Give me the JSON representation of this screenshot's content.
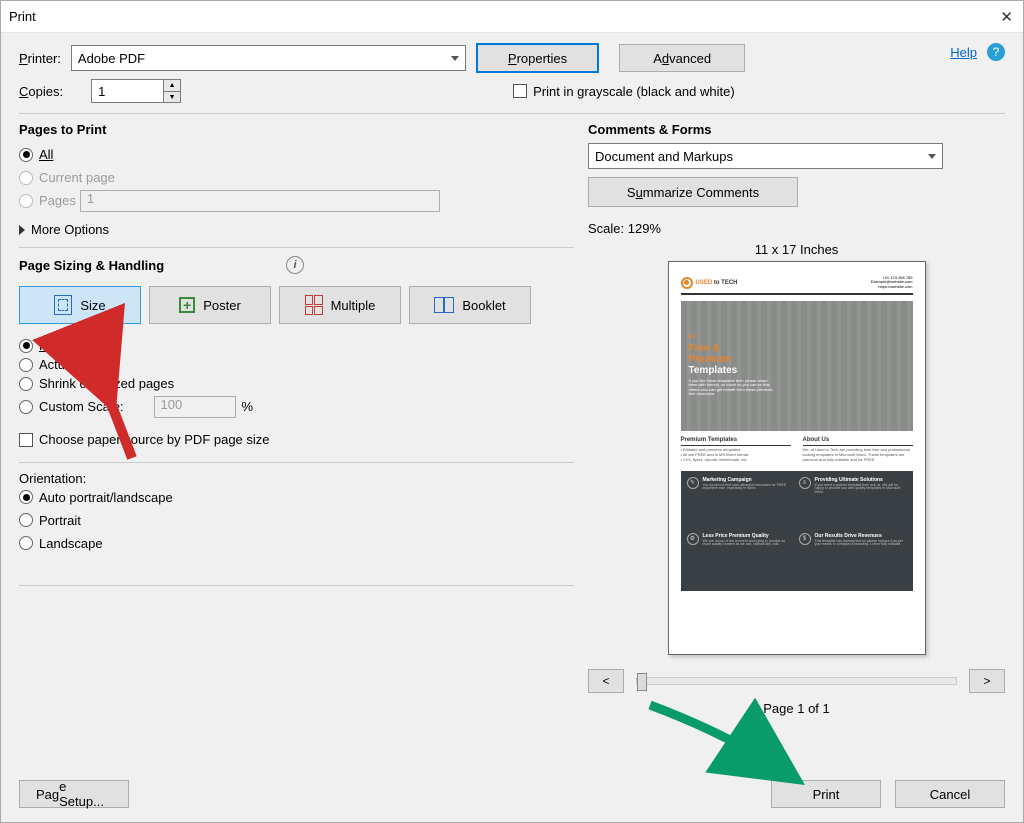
{
  "window": {
    "title": "Print"
  },
  "labels": {
    "printer": "Printer:",
    "copies": "Copies:"
  },
  "printer_value": "Adobe PDF",
  "copies_value": "1",
  "buttons": {
    "properties": "Properties",
    "advanced": "Advanced",
    "page_setup": "Page Setup...",
    "print": "Print",
    "cancel": "Cancel",
    "summarize": "Summarize Comments"
  },
  "help": {
    "link": "Help",
    "icon": "?"
  },
  "grayscale_label": "Print in grayscale (black and white)",
  "pages_to_print": {
    "title": "Pages to Print",
    "all": "All",
    "current": "Current page",
    "pages": "Pages",
    "pages_value": "1",
    "more_options": "More Options"
  },
  "sizing": {
    "title": "Page Sizing & Handling",
    "size": "Size",
    "poster": "Poster",
    "multiple": "Multiple",
    "booklet": "Booklet",
    "fit": "Fit",
    "actual": "Actual size",
    "shrink": "Shrink oversized pages",
    "custom": "Custom Scale:",
    "custom_value": "100",
    "percent": "%",
    "choose_paper": "Choose paper source by PDF page size"
  },
  "orientation": {
    "title": "Orientation:",
    "auto": "Auto portrait/landscape",
    "portrait": "Portrait",
    "landscape": "Landscape"
  },
  "comments_forms": {
    "title": "Comments & Forms",
    "value": "Document and Markups"
  },
  "preview": {
    "scale_label": "Scale: 129%",
    "dimensions": "11 x 17 Inches",
    "prev": "<",
    "next": ">",
    "page_of": "Page 1 of 1",
    "doc": {
      "brand1": "USED",
      "brand2": "to TECH",
      "hero_free": "Free &",
      "hero_premium": "Premium",
      "hero_templates": "Templates",
      "mid1_title": "Premium Templates",
      "mid2_title": "About Us",
      "d1_title": "Marketing Campaign",
      "d2_title": "Providing Ultimate Solutions",
      "d3_title": "Less Price Premium Quality",
      "d4_title": "Our Results Drive Revenues"
    }
  }
}
